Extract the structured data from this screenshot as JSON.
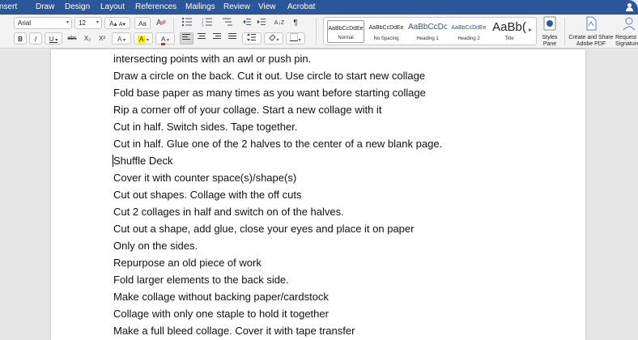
{
  "menu": {
    "tabs": [
      {
        "name": "insert",
        "label": "nsert"
      },
      {
        "name": "draw",
        "label": "Draw"
      },
      {
        "name": "design",
        "label": "Design"
      },
      {
        "name": "layout",
        "label": "Layout"
      },
      {
        "name": "references",
        "label": "References"
      },
      {
        "name": "mailings",
        "label": "Mailings"
      },
      {
        "name": "review",
        "label": "Review"
      },
      {
        "name": "view",
        "label": "View"
      },
      {
        "name": "acrobat",
        "label": "Acrobat"
      }
    ],
    "user_icon": "user-icon",
    "bar_color": "#2b579a"
  },
  "ribbon": {
    "font_name": "Arial",
    "font_size": "12",
    "grow_font": "A▴",
    "shrink_font": "A▾",
    "change_case": "Aa",
    "bold": "B",
    "italic": "I",
    "underline": "U",
    "strikethrough": "abc",
    "subscript": "X₂",
    "superscript": "X²",
    "text_effects": "A",
    "highlight": "A",
    "font_color": "A",
    "font_color_value": "#e02020",
    "highlight_value": "#ffe600",
    "sort": "A↓Z",
    "pilcrow": "¶",
    "styles": [
      {
        "sample": "AaBbCcDdEe",
        "name": "Normal"
      },
      {
        "sample": "AaBbCcDdEe",
        "name": "No Spacing"
      },
      {
        "sample": "AaBbCcDc",
        "name": "Heading 1"
      },
      {
        "sample": "AaBbCcDdEe",
        "name": "Heading 2"
      },
      {
        "sample": "AaBb(",
        "name": "Title"
      }
    ],
    "styles_pane": "Styles\nPane",
    "create_share_pdf": "Create and Share\nAdobe PDF",
    "request_signatures": "Request\nSignatures"
  },
  "document": {
    "lines": [
      "intersecting points with an awl or push pin.",
      "Draw a circle on the back. Cut it out. Use circle to start new collage",
      "Fold base paper as many times as you want before starting collage",
      "Rip a corner off of your collage. Start a new collage with it",
      "Cut in half. Switch sides. Tape together.",
      "Cut in half. Glue one of the 2 halves to the center of a new blank page.",
      "Shuffle Deck",
      "Cover it with counter space(s)/shape(s)",
      "Cut out shapes. Collage with the off cuts",
      "Cut 2 collages in half and switch on of the halves.",
      "Cut out a shape, add glue, close your eyes and place it on paper",
      "Only on the sides.",
      "Repurpose an old piece of work",
      "Fold larger elements to the back side.",
      "Make collage without backing paper/cardstock",
      "Collage with only one staple to hold it together",
      "Make a full bleed collage. Cover it with tape transfer"
    ]
  }
}
